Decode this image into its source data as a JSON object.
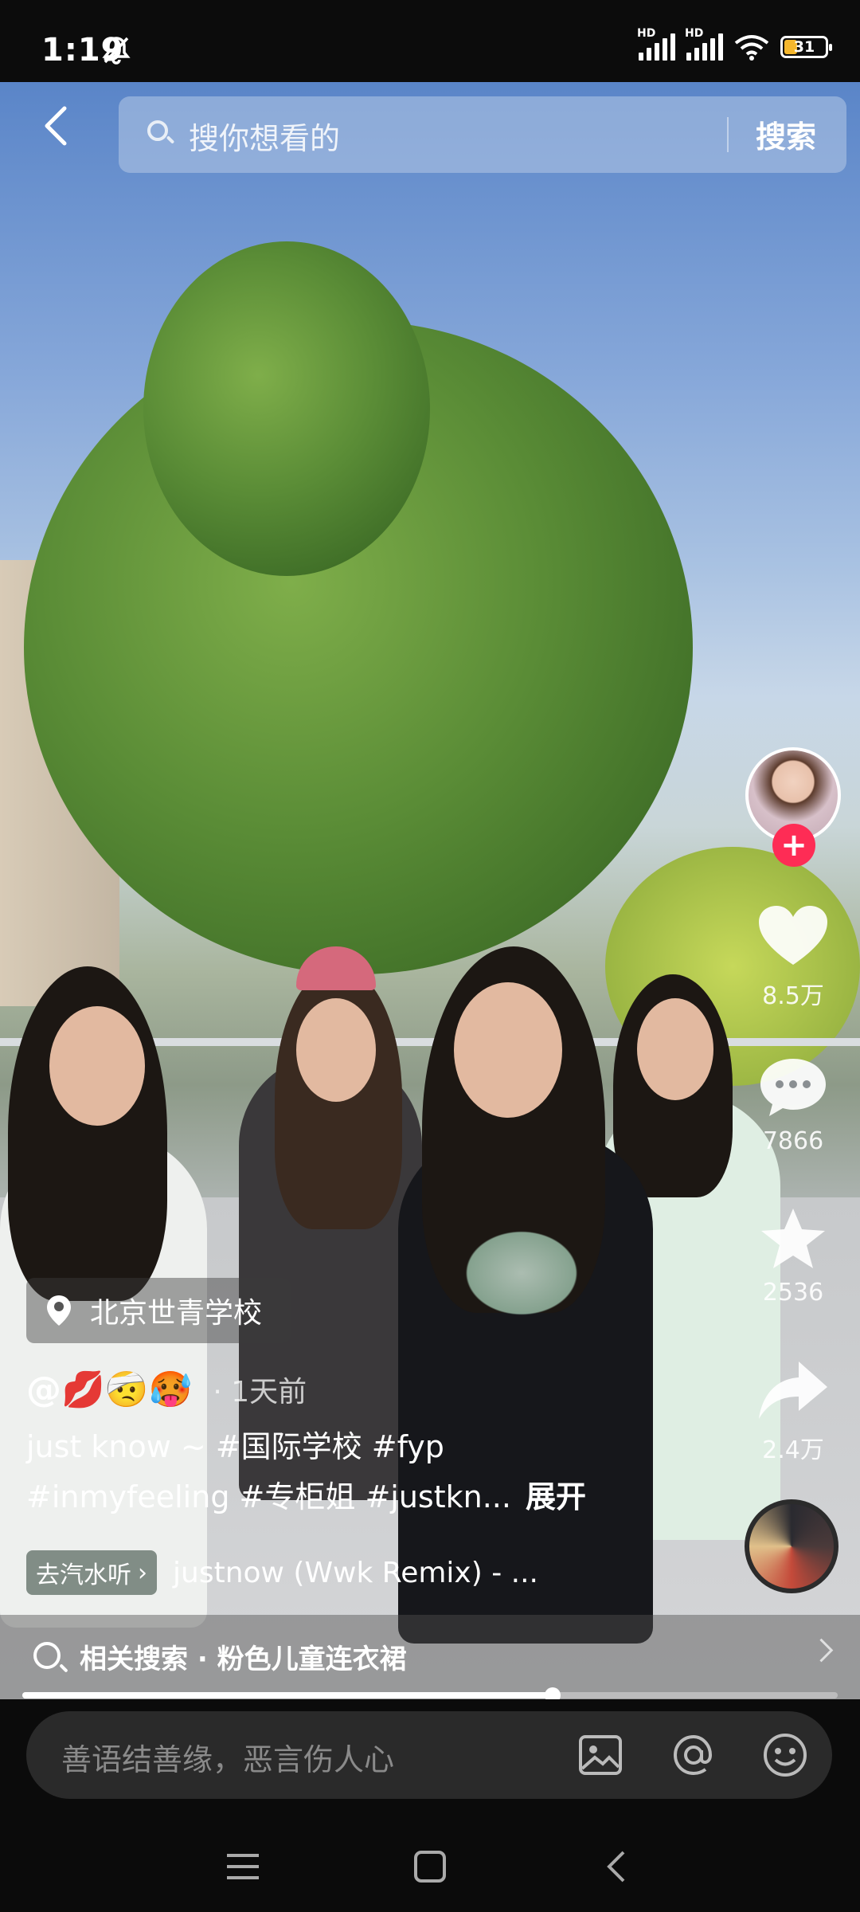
{
  "status_bar": {
    "time": "1:19",
    "battery": "31",
    "network_label": "HD"
  },
  "search": {
    "placeholder": "搜你想看的",
    "submit_label": "搜索"
  },
  "actions": {
    "likes": "8.5万",
    "comments": "7866",
    "favorites": "2536",
    "shares": "2.4万"
  },
  "post": {
    "location": "北京世青学校",
    "author": "@💋🤕🥵",
    "time_ago": "· 1天前",
    "caption_line1": "just know ~ #国际学校 #fyp",
    "caption_line2": "#inmyfeeling #专柜姐 #justkn...",
    "expand_label": "展开"
  },
  "music": {
    "badge": "去汽水听",
    "title": "justnow (Wwk Remix) - ..."
  },
  "related_search": {
    "label": "相关搜索 · 粉色儿童连衣裙"
  },
  "video_progress": 0.65,
  "comment": {
    "placeholder": "善语结善缘，恶言伤人心"
  },
  "colors": {
    "follow_accent": "#fe2c55",
    "battery_fill": "#f5b72d"
  }
}
